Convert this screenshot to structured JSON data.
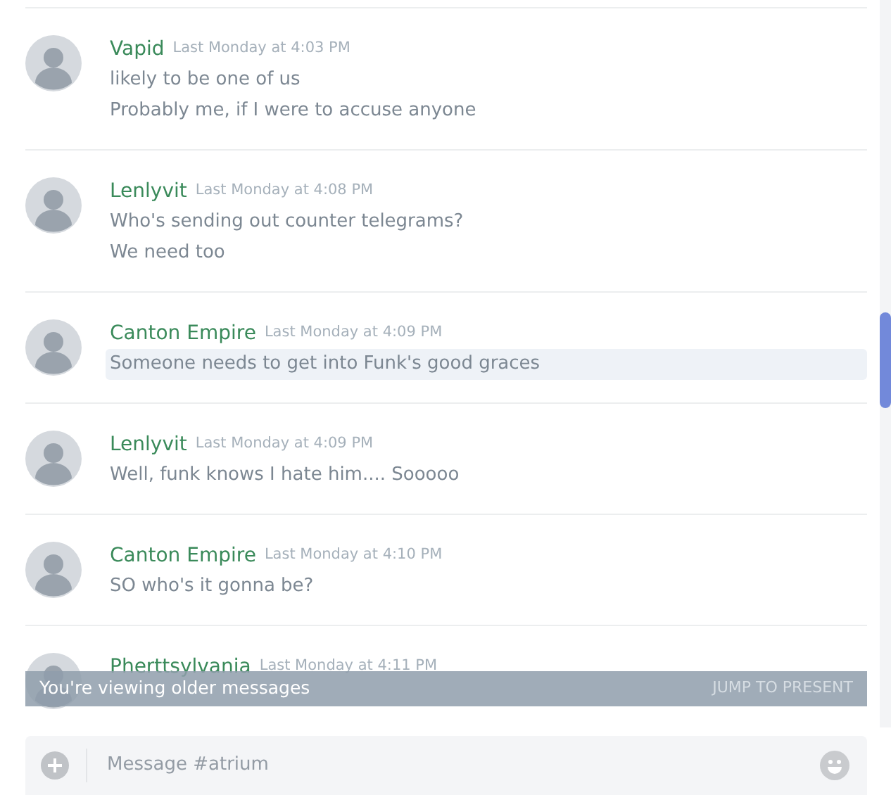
{
  "messages": [
    {
      "author": "Vapid",
      "timestamp": "Last Monday at 4:03 PM",
      "lines": [
        "likely to be one of us",
        "Probably me, if I were to accuse anyone"
      ],
      "hovered": false
    },
    {
      "author": "Lenlyvit",
      "timestamp": "Last Monday at 4:08 PM",
      "lines": [
        "Who's sending out counter telegrams?",
        "We need too"
      ],
      "hovered": false
    },
    {
      "author": "Canton Empire",
      "timestamp": "Last Monday at 4:09 PM",
      "lines": [
        "Someone needs to get into Funk's good graces"
      ],
      "hovered": true
    },
    {
      "author": "Lenlyvit",
      "timestamp": "Last Monday at 4:09 PM",
      "lines": [
        "Well, funk knows I hate him.... Sooooo"
      ],
      "hovered": false
    },
    {
      "author": "Canton Empire",
      "timestamp": "Last Monday at 4:10 PM",
      "lines": [
        "SO who's it gonna be?"
      ],
      "hovered": false
    },
    {
      "author": "Pherttsylvania",
      "timestamp": "Last Monday at 4:11 PM"
    }
  ],
  "older_banner": {
    "text": "You're viewing older messages",
    "action": "JUMP TO PRESENT"
  },
  "composer": {
    "placeholder": "Message #atrium"
  }
}
